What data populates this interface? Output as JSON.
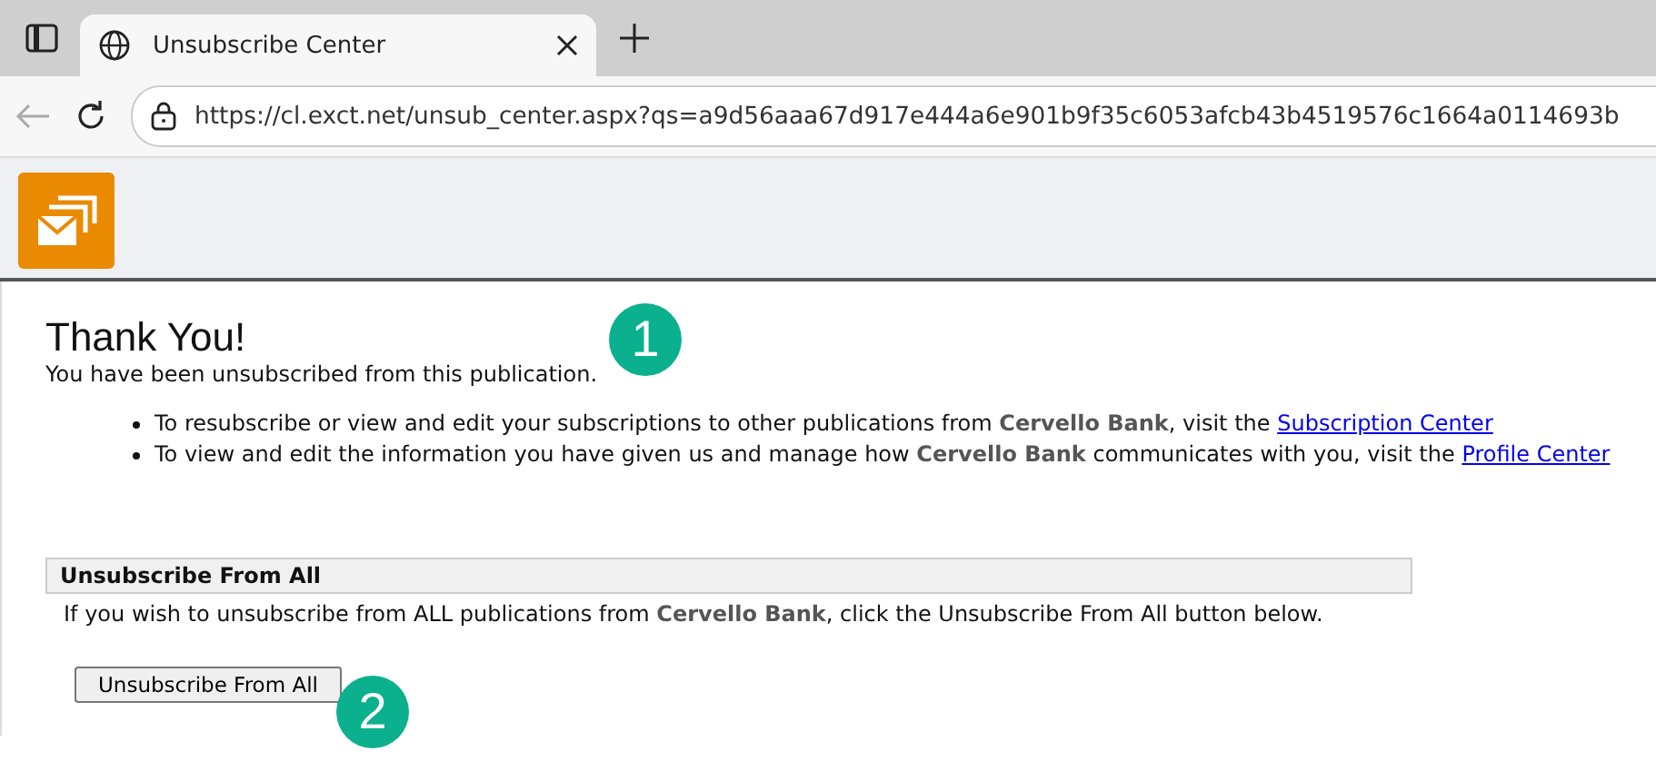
{
  "browser": {
    "tab_title": "Unsubscribe Center",
    "url": "https://cl.exct.net/unsub_center.aspx?qs=a9d56aaa67d917e444a6e901b9f35c6053afcb43b4519576c1664a0114693b"
  },
  "page": {
    "title": "Thank You!",
    "message": "You have been unsubscribed from this publication.",
    "bullets": [
      {
        "text": "To resubscribe or view and edit your subscriptions to other publications from **Cervello Bank**, visit the",
        "link": "Subscription Center"
      },
      {
        "text": "To view and edit the information you have given us and manage how **Cervello Bank** communicates with you, visit the",
        "link": "Profile Center"
      }
    ],
    "section": {
      "heading": "Unsubscribe From All",
      "text": "If you wish to unsubscribe from ALL publications from **Cervello Bank**, click the Unsubscribe From All button below.",
      "button": "Unsubscribe From All"
    }
  },
  "callouts": [
    "1",
    "2"
  ]
}
